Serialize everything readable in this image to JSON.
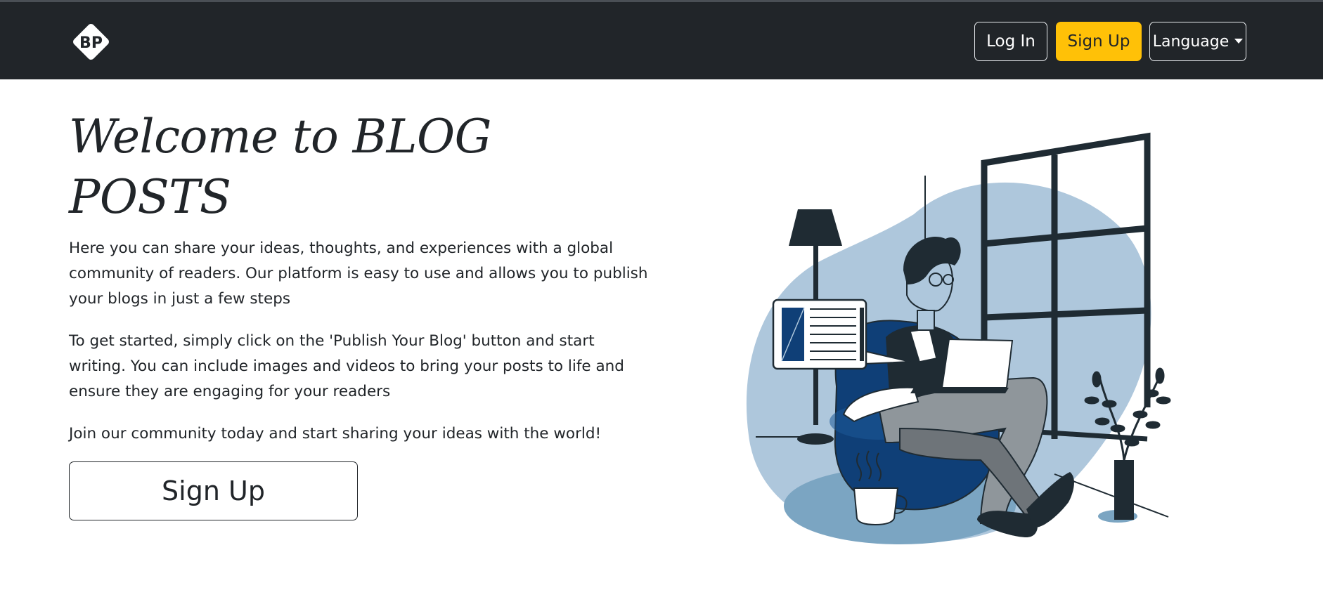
{
  "navbar": {
    "logo_text": "BP",
    "login_label": "Log In",
    "signup_label": "Sign Up",
    "language_label": "Language"
  },
  "hero": {
    "title": "Welcome to BLOG POSTS",
    "paragraph1": "Here you can share your ideas, thoughts, and experiences with a global community of readers. Our platform is easy to use and allows you to publish your blogs in just a few steps",
    "paragraph2": "To get started, simply click on the 'Publish Your Blog' button and start writing. You can include images and videos to bring your posts to life and ensure they are engaging for your readers",
    "paragraph3": "Join our community today and start sharing your ideas with the world!",
    "signup_button": "Sign Up"
  },
  "colors": {
    "navbar_bg": "#212529",
    "accent": "#ffc107",
    "illustration_blue_light": "#aec7dc",
    "illustration_blue_dark": "#0f3f77",
    "illustration_ink": "#1f2b33"
  },
  "icons": {
    "logo": "bp-diamond-logo",
    "dropdown": "caret-down-icon"
  }
}
